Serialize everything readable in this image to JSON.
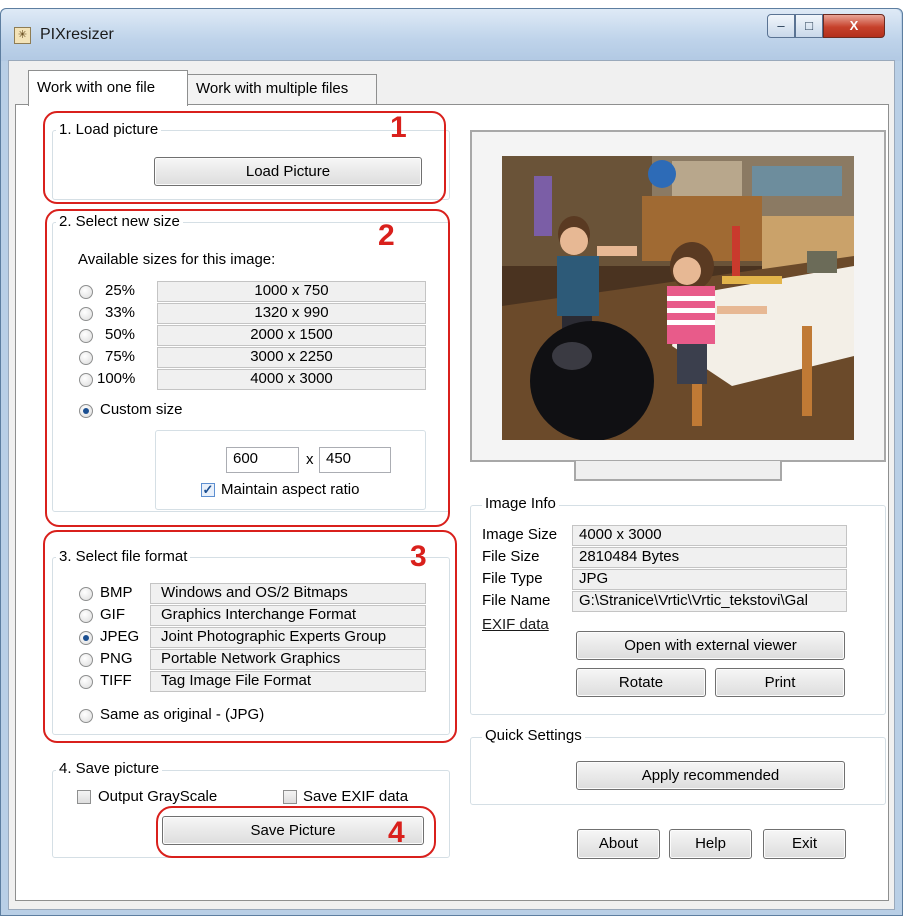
{
  "window": {
    "title": "PIXresizer",
    "minimize": "‒",
    "maximize": "□",
    "close": "X"
  },
  "tabs": [
    {
      "label": "Work with one file"
    },
    {
      "label": "Work with multiple files"
    }
  ],
  "section1": {
    "legend": "1. Load picture",
    "button": "Load Picture",
    "marker": "1"
  },
  "section2": {
    "legend": "2. Select new size",
    "marker": "2",
    "available_label": "Available sizes for this image:",
    "sizes": [
      {
        "pct": "25%",
        "dims": "1000 x 750"
      },
      {
        "pct": "33%",
        "dims": "1320 x 990"
      },
      {
        "pct": "50%",
        "dims": "2000 x 1500"
      },
      {
        "pct": "75%",
        "dims": "3000 x 2250"
      },
      {
        "pct": "100%",
        "dims": "4000 x 3000"
      }
    ],
    "custom_label": "Custom size",
    "custom_width": "600",
    "custom_x": "x",
    "custom_height": "450",
    "aspect_label": "Maintain aspect ratio",
    "aspect_checked": "✓"
  },
  "section3": {
    "legend": "3. Select file format",
    "marker": "3",
    "formats": [
      {
        "name": "BMP",
        "desc": "Windows and OS/2 Bitmaps"
      },
      {
        "name": "GIF",
        "desc": "Graphics Interchange Format"
      },
      {
        "name": "JPEG",
        "desc": "Joint Photographic Experts Group"
      },
      {
        "name": "PNG",
        "desc": "Portable Network Graphics"
      },
      {
        "name": "TIFF",
        "desc": "Tag Image File Format"
      }
    ],
    "same_label": "Same as original  - (JPG)"
  },
  "section4": {
    "legend": "4. Save picture",
    "marker": "4",
    "grayscale_label": "Output GrayScale",
    "exif_label": "Save EXIF data",
    "button": "Save Picture"
  },
  "image_info": {
    "legend": "Image Info",
    "rows": [
      {
        "label": "Image Size",
        "value": "4000 x 3000"
      },
      {
        "label": "File Size",
        "value": "2810484 Bytes"
      },
      {
        "label": "File Type",
        "value": "JPG"
      },
      {
        "label": "File Name",
        "value": "G:\\Stranice\\Vrtic\\Vrtic_tekstovi\\Gal"
      }
    ],
    "exif_link": "EXIF data",
    "open_button": "Open with external viewer",
    "rotate_button": "Rotate",
    "print_button": "Print"
  },
  "quick_settings": {
    "legend": "Quick Settings",
    "button": "Apply recommended"
  },
  "footer": {
    "about": "About",
    "help": "Help",
    "exit": "Exit"
  },
  "colors": {
    "accent_red": "#d9201c",
    "radio_dot": "#1b4f91"
  }
}
